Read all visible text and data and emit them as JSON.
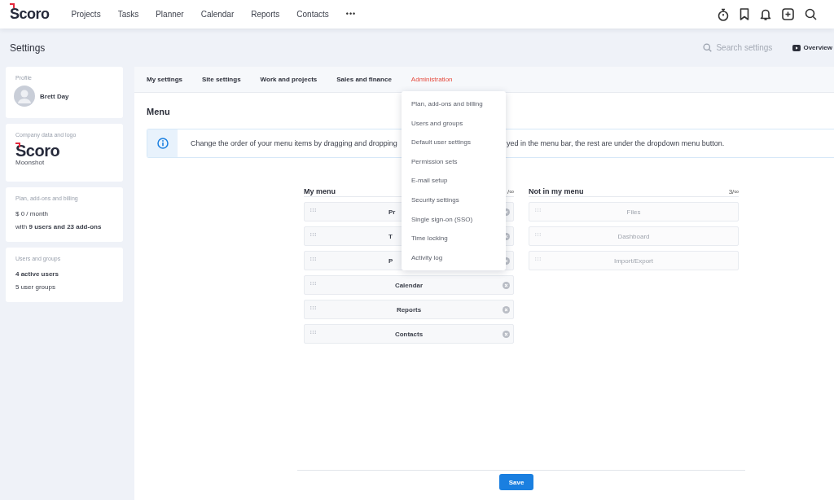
{
  "topbar": {
    "logo": "Scoro",
    "nav": [
      "Projects",
      "Tasks",
      "Planner",
      "Calendar",
      "Reports",
      "Contacts"
    ],
    "more": "•••"
  },
  "header": {
    "title": "Settings",
    "search": {
      "placeholder": "Search settings"
    },
    "overview": "Overview"
  },
  "sidebar": [
    {
      "kind": "profile",
      "title": "Profile",
      "name": "Brett Day"
    },
    {
      "kind": "company",
      "title": "Company data and logo",
      "logo": "Scoro",
      "company": "Moonshot"
    },
    {
      "kind": "lines",
      "title": "Plan, add-ons and billing",
      "lines": [
        "$ 0 / month",
        "with **9 users and 23 add-ons**"
      ]
    },
    {
      "kind": "lines",
      "title": "Users and groups",
      "lines": [
        "**4 active users**",
        "5 user groups"
      ]
    }
  ],
  "tabs": [
    {
      "label": "My settings",
      "selected": false
    },
    {
      "label": "Site settings",
      "selected": false
    },
    {
      "label": "Work and projects",
      "selected": false
    },
    {
      "label": "Sales and finance",
      "selected": false
    },
    {
      "label": "Administration",
      "selected": true
    }
  ],
  "section_title": "Menu",
  "info": {
    "text_left": "Change the order of your menu items by dragging and dropping",
    "text_right": "yed in the menu bar, the rest are under the dropdown menu button."
  },
  "my_menu": {
    "title": "My menu",
    "count": "/∞",
    "items": [
      {
        "label": "Pr",
        "kind": "cut"
      },
      {
        "label": "T",
        "kind": "cut"
      },
      {
        "label": "P",
        "kind": "cut"
      },
      {
        "label": "Calendar",
        "kind": "full"
      },
      {
        "label": "Reports",
        "kind": "full"
      },
      {
        "label": "Contacts",
        "kind": "full"
      }
    ]
  },
  "not_in_menu": {
    "title": "Not in my menu",
    "count": "3/∞",
    "items": [
      "Files",
      "Dashboard",
      "Import/Export"
    ]
  },
  "save": "Save",
  "dropdown": [
    "Plan, add-ons and billing",
    "Users and groups",
    "Default user settings",
    "Permission sets",
    "E-mail setup",
    "Security settings",
    "Single sign-on (SSO)",
    "Time locking",
    "Activity log"
  ]
}
